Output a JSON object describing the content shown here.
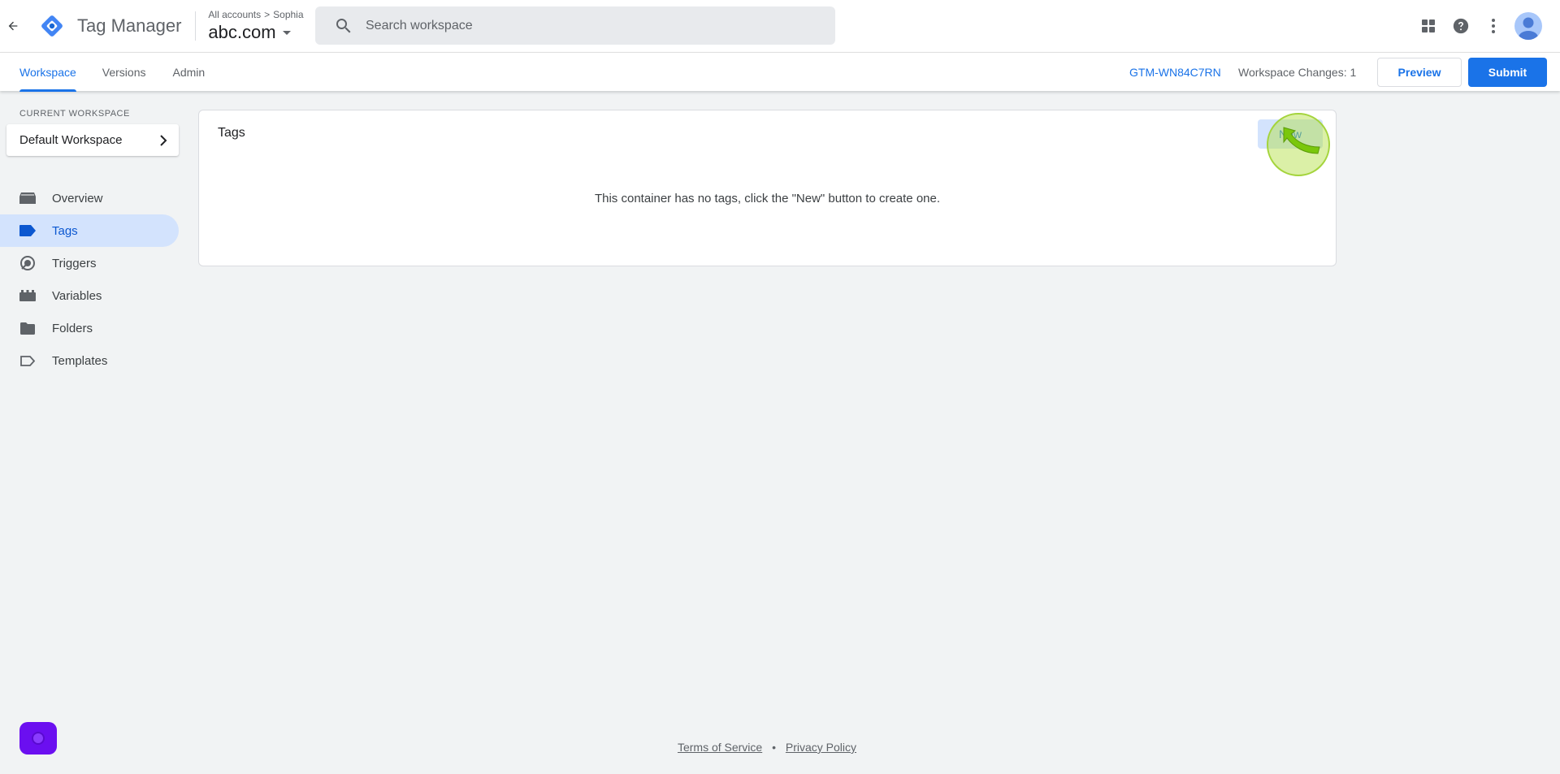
{
  "header": {
    "app_title": "Tag Manager",
    "breadcrumb": {
      "all_accounts": "All accounts",
      "separator": ">",
      "account": "Sophia"
    },
    "container_name": "abc.com",
    "search_placeholder": "Search workspace"
  },
  "subnav": {
    "tabs": [
      {
        "label": "Workspace",
        "active": true
      },
      {
        "label": "Versions",
        "active": false
      },
      {
        "label": "Admin",
        "active": false
      }
    ],
    "container_id": "GTM-WN84C7RN",
    "workspace_changes": "Workspace Changes: 1",
    "preview_label": "Preview",
    "submit_label": "Submit"
  },
  "sidebar": {
    "current_workspace_label": "CURRENT WORKSPACE",
    "workspace_name": "Default Workspace",
    "items": [
      {
        "label": "Overview",
        "icon": "overview-icon",
        "active": false
      },
      {
        "label": "Tags",
        "icon": "tag-icon",
        "active": true
      },
      {
        "label": "Triggers",
        "icon": "trigger-icon",
        "active": false
      },
      {
        "label": "Variables",
        "icon": "variables-icon",
        "active": false
      },
      {
        "label": "Folders",
        "icon": "folder-icon",
        "active": false
      },
      {
        "label": "Templates",
        "icon": "template-icon",
        "active": false
      }
    ]
  },
  "main": {
    "title": "Tags",
    "new_button_label": "New",
    "empty_message": "This container has no tags, click the \"New\" button to create one."
  },
  "footer": {
    "terms": "Terms of Service",
    "separator": "•",
    "privacy": "Privacy Policy"
  },
  "colors": {
    "accent": "#1a73e8",
    "active_nav_bg": "#d3e3fd",
    "page_bg": "#f1f3f4",
    "click_highlight": "#a4d43c",
    "fab": "#6b0ff0"
  }
}
